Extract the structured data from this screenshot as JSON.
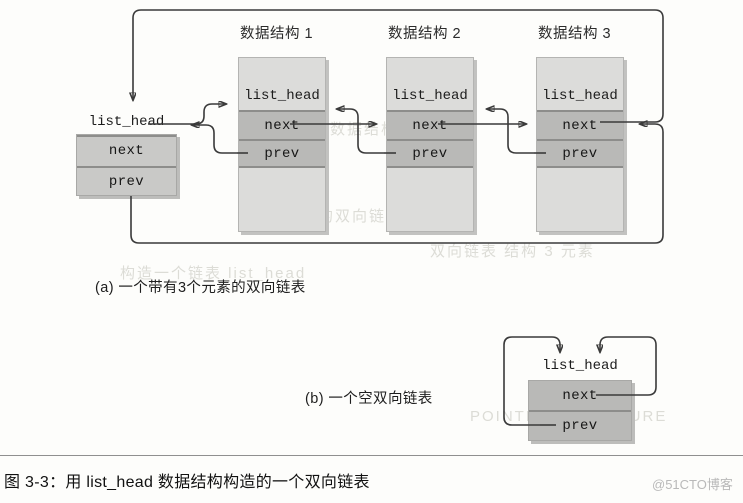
{
  "figure": {
    "caption": "图 3-3：用 list_head 数据结构构造的一个双向链表",
    "watermark": "@51CTO博客"
  },
  "part_a": {
    "caption": "(a)  一个带有3个元素的双向链表",
    "head": {
      "label": "list_head",
      "fields": [
        "next",
        "prev"
      ]
    },
    "nodes": [
      {
        "title": "数据结构 1",
        "label": "list_head",
        "fields": [
          "next",
          "prev"
        ]
      },
      {
        "title": "数据结构 2",
        "label": "list_head",
        "fields": [
          "next",
          "prev"
        ]
      },
      {
        "title": "数据结构 3",
        "label": "list_head",
        "fields": [
          "next",
          "prev"
        ]
      }
    ]
  },
  "part_b": {
    "caption": "(b)  一个空双向链表",
    "head": {
      "label": "list_head",
      "fields": [
        "next",
        "prev"
      ]
    }
  },
  "bleed_text": [
    "数据结构的双向链表元素",
    "构造一个链表 list_head",
    "双向链表 结构 3 元素",
    "POINTER STRUCTURE",
    "数据结构 双向 链表"
  ],
  "colors": {
    "box_fill": "#dcdcda",
    "field_fill": "#b9b9b7",
    "wire": "#3a3a3a",
    "page": "#fdfdfb"
  }
}
